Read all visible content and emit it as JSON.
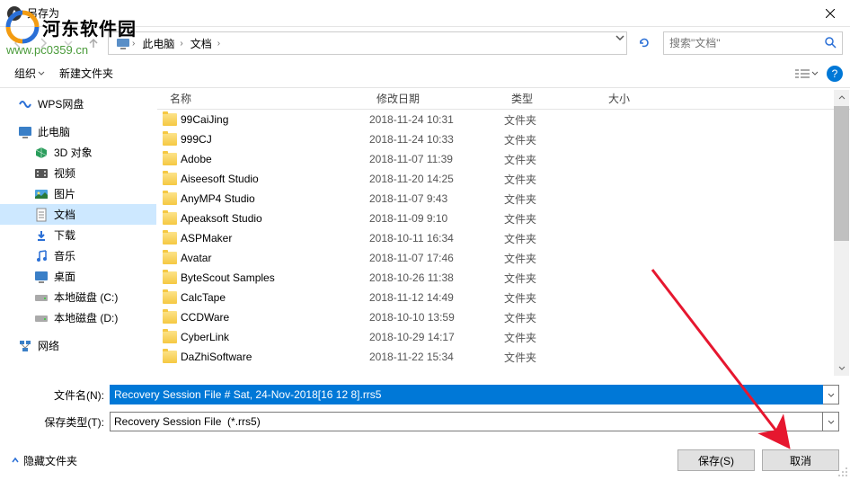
{
  "window": {
    "title": "另存为"
  },
  "watermark": {
    "text": "河东软件园",
    "url": "www.pc0359.cn"
  },
  "breadcrumb": {
    "seg1": "此电脑",
    "seg2": "文档"
  },
  "search": {
    "placeholder": "搜索\"文档\""
  },
  "toolbar": {
    "organize": "组织",
    "new_folder": "新建文件夹"
  },
  "sidebar": {
    "items": [
      {
        "label": "WPS网盘",
        "indent": 0,
        "type": "wps"
      },
      {
        "spacer": true
      },
      {
        "label": "此电脑",
        "indent": 0,
        "type": "pc"
      },
      {
        "label": "3D 对象",
        "indent": 1,
        "type": "3d"
      },
      {
        "label": "视频",
        "indent": 1,
        "type": "video"
      },
      {
        "label": "图片",
        "indent": 1,
        "type": "pic"
      },
      {
        "label": "文档",
        "indent": 1,
        "type": "doc",
        "selected": true
      },
      {
        "label": "下载",
        "indent": 1,
        "type": "download"
      },
      {
        "label": "音乐",
        "indent": 1,
        "type": "music"
      },
      {
        "label": "桌面",
        "indent": 1,
        "type": "desktop"
      },
      {
        "label": "本地磁盘 (C:)",
        "indent": 1,
        "type": "disk"
      },
      {
        "label": "本地磁盘 (D:)",
        "indent": 1,
        "type": "disk"
      },
      {
        "spacer": true
      },
      {
        "label": "网络",
        "indent": 0,
        "type": "network"
      }
    ]
  },
  "columns": {
    "name": "名称",
    "date": "修改日期",
    "type": "类型",
    "size": "大小"
  },
  "files": [
    {
      "name": "99CaiJing",
      "date": "2018-11-24 10:31",
      "type": "文件夹"
    },
    {
      "name": "999CJ",
      "date": "2018-11-24 10:33",
      "type": "文件夹"
    },
    {
      "name": "Adobe",
      "date": "2018-11-07 11:39",
      "type": "文件夹"
    },
    {
      "name": "Aiseesoft Studio",
      "date": "2018-11-20 14:25",
      "type": "文件夹"
    },
    {
      "name": "AnyMP4 Studio",
      "date": "2018-11-07 9:43",
      "type": "文件夹"
    },
    {
      "name": "Apeaksoft Studio",
      "date": "2018-11-09 9:10",
      "type": "文件夹"
    },
    {
      "name": "ASPMaker",
      "date": "2018-10-11 16:34",
      "type": "文件夹"
    },
    {
      "name": "Avatar",
      "date": "2018-11-07 17:46",
      "type": "文件夹"
    },
    {
      "name": "ByteScout Samples",
      "date": "2018-10-26 11:38",
      "type": "文件夹"
    },
    {
      "name": "CalcTape",
      "date": "2018-11-12 14:49",
      "type": "文件夹"
    },
    {
      "name": "CCDWare",
      "date": "2018-10-10 13:59",
      "type": "文件夹"
    },
    {
      "name": "CyberLink",
      "date": "2018-10-29 14:17",
      "type": "文件夹"
    },
    {
      "name": "DaZhiSoftware",
      "date": "2018-11-22 15:34",
      "type": "文件夹"
    }
  ],
  "filename": {
    "label": "文件名(N):",
    "value": "Recovery Session File # Sat, 24-Nov-2018[16 12 8].rrs5"
  },
  "filetype": {
    "label": "保存类型(T):",
    "value": "Recovery Session File  (*.rrs5)"
  },
  "footer": {
    "hide_folders": "隐藏文件夹",
    "save": "保存(S)",
    "cancel": "取消"
  }
}
